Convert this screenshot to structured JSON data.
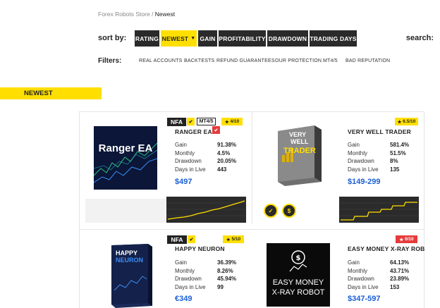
{
  "breadcrumb": {
    "root": "Forex Robots Store",
    "separator": " / ",
    "current": "Newest"
  },
  "sort": {
    "label": "sort by:",
    "buttons": [
      "RATING",
      "NEWEST",
      "GAIN",
      "PROFITABILITY",
      "DRAWDOWN",
      "TRADING DAYS"
    ],
    "active": "NEWEST",
    "search_label": "search:"
  },
  "filters": {
    "label": "Filters:",
    "items": [
      "REAL ACCOUNTS",
      "BACKTESTS",
      "REFUND GUARANTEES",
      "OUR PROTECTION",
      "MT4/5",
      "BAD REPUTATION"
    ]
  },
  "section": {
    "title": "NEWEST"
  },
  "stat_labels": {
    "gain": "Gain",
    "monthly": "Monthly",
    "drawdown": "Drawdown",
    "days": "Days in Live"
  },
  "colors": {
    "accent": "#ffdf00",
    "dark": "#2a2a2a",
    "price": "#1a5fd6",
    "bad": "#e63b3b"
  },
  "products": [
    {
      "name": "RANGER EA",
      "thumb_text": "Ranger EA",
      "badges": {
        "nfa": "NFA",
        "mt": "MT4/5"
      },
      "rating": "4/10",
      "gain": "91.38%",
      "monthly": "4.5%",
      "drawdown": "20.05%",
      "days": "443",
      "price": "$497"
    },
    {
      "name": "VERY WELL TRADER",
      "thumb_text_1": "VERY",
      "thumb_text_2": "WELL",
      "thumb_text_3": "TRADER",
      "rating": "6.5/10",
      "gain": "581.4%",
      "monthly": "51.5%",
      "drawdown": "8%",
      "days": "135",
      "price": "$149-299"
    },
    {
      "name": "HAPPY NEURON",
      "thumb_text_1": "HAPPY",
      "thumb_text_2": "NEURON",
      "badges": {
        "nfa": "NFA"
      },
      "rating": "5/10",
      "gain": "36.39%",
      "monthly": "8.26%",
      "drawdown": "45.94%",
      "days": "99",
      "price": "€349"
    },
    {
      "name": "EASY MONEY X-RAY ROBO",
      "thumb_text_1": "EASY MONEY",
      "thumb_text_2": "X-RAY ROBOT",
      "rating": "0/10",
      "gain": "64.13%",
      "monthly": "43.71%",
      "drawdown": "23.89%",
      "days": "153",
      "price": "$347-597"
    }
  ]
}
